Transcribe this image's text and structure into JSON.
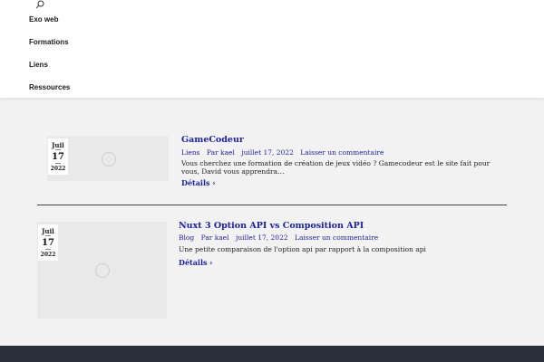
{
  "header": {
    "nav": [
      "Exo web",
      "Formations",
      "Liens",
      "Ressources"
    ]
  },
  "posts": [
    {
      "title": "GameCodeur",
      "category": "Liens",
      "author": "Par kael",
      "date": "juillet 17, 2022",
      "comment": "Laisser un commentaire",
      "excerpt": "Vous cherchez une formation de création de jeux vidéo ? Gamecodeur est le site fait pour vous, David vous apprendra…",
      "details": "Détails",
      "badge": {
        "month": "Juil",
        "day": "17",
        "year": "2022"
      }
    },
    {
      "title": "Nuxt 3 Option API vs Composition API",
      "category": "Blog",
      "author": "Par kael",
      "date": "juillet 17, 2022",
      "comment": "Laisser un commentaire",
      "excerpt": "Une petite comparaison de l'option api par rapport à la composition api",
      "details": "Détails",
      "badge": {
        "month": "Juil",
        "day": "17",
        "year": "2022"
      }
    }
  ],
  "colors": {
    "link": "#1a1fa0",
    "footer": "#2b2e3b",
    "background": "#f2f2f2"
  }
}
